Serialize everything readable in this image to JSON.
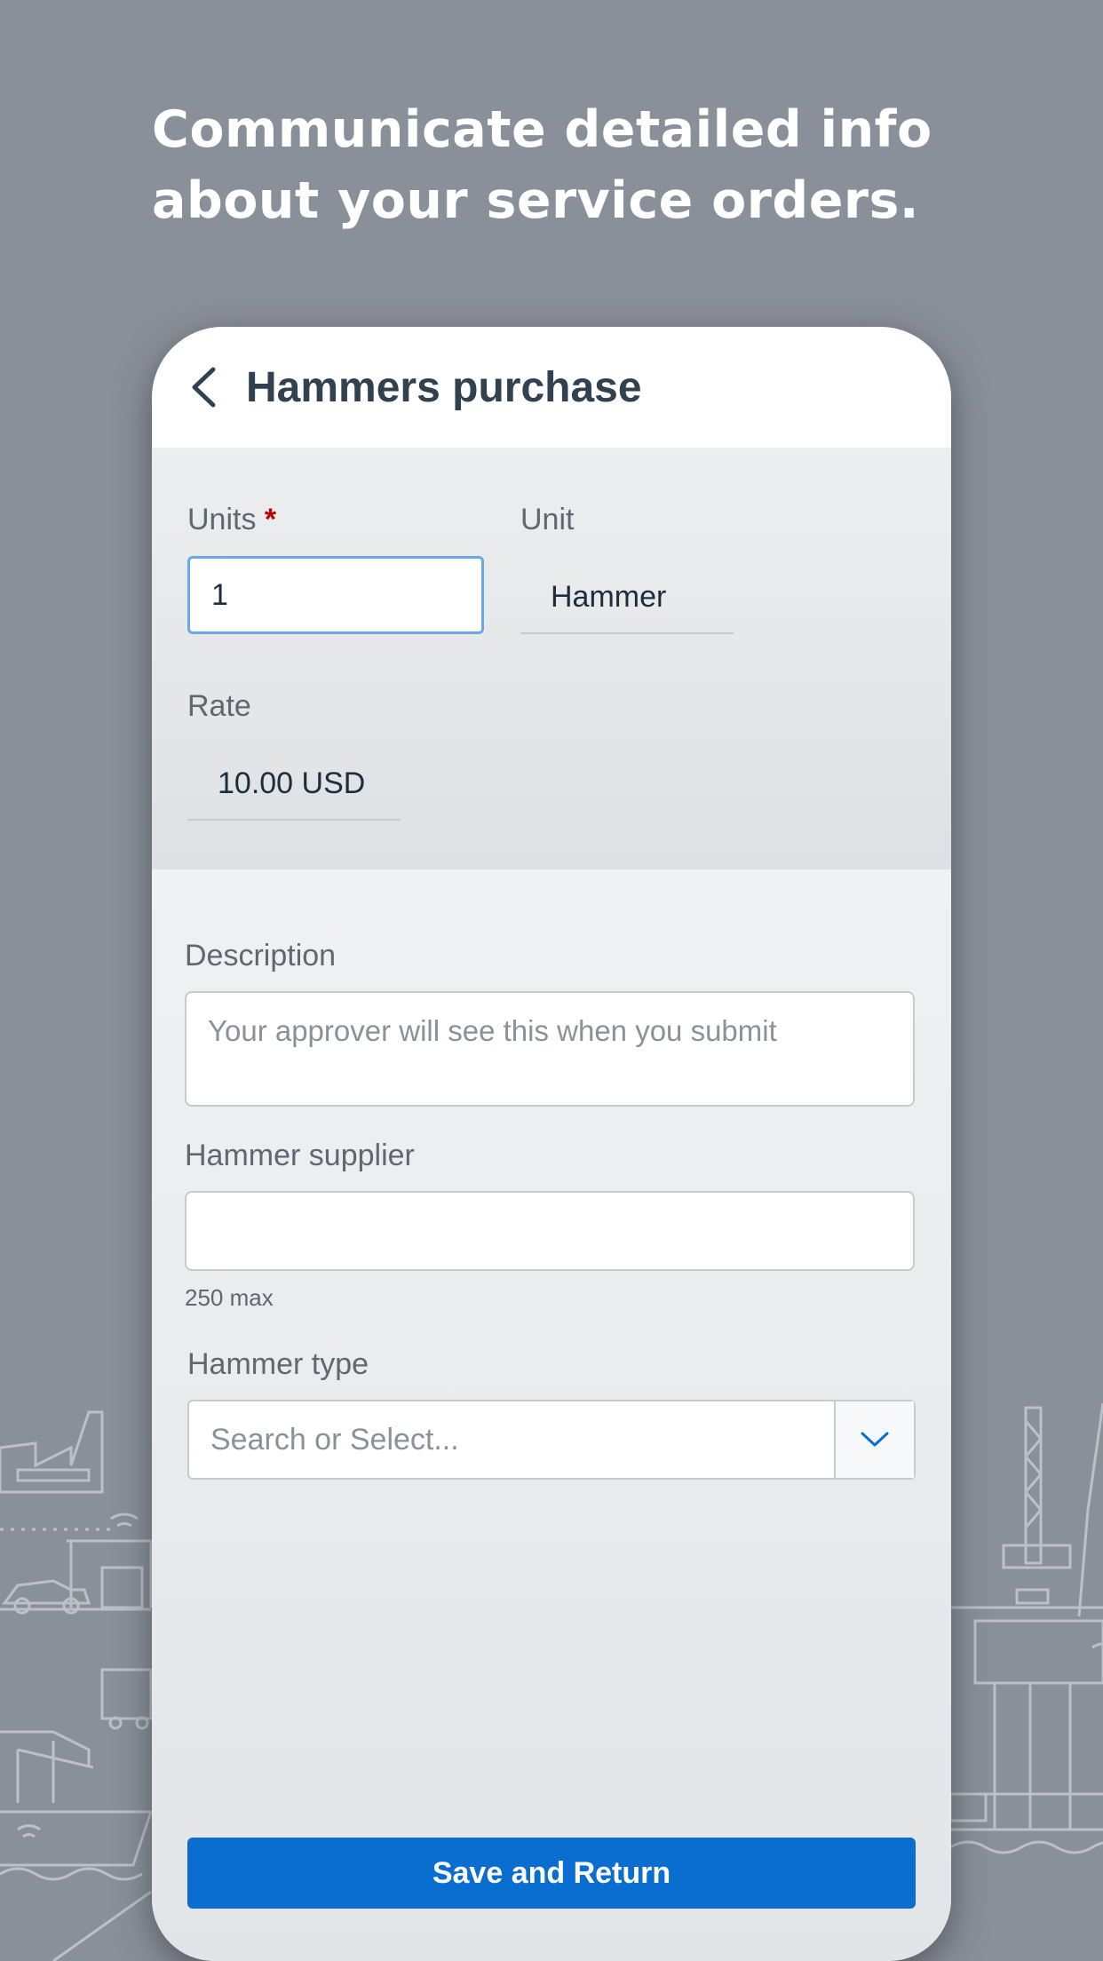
{
  "headline": {
    "line1": "Communicate detailed info",
    "line2": "about your service orders."
  },
  "nav": {
    "title": "Hammers purchase"
  },
  "form": {
    "units_label": "Units",
    "units_required_mark": "*",
    "units_value": "1",
    "unit_label": "Unit",
    "unit_value": "Hammer",
    "rate_label": "Rate",
    "rate_value": "10.00 USD",
    "description_label": "Description",
    "description_placeholder": "Your approver will see this when you submit",
    "supplier_label": "Hammer supplier",
    "supplier_value": "",
    "supplier_hint": "250 max",
    "type_label": "Hammer type",
    "type_placeholder": "Search or Select..."
  },
  "actions": {
    "save_label": "Save and Return"
  },
  "colors": {
    "background": "#8a9099",
    "accent": "#0a6ed1",
    "focus_border": "#6aa8e8",
    "required": "#bb0000"
  },
  "icons": {
    "back": "chevron-left-icon",
    "dropdown": "chevron-down-icon"
  }
}
